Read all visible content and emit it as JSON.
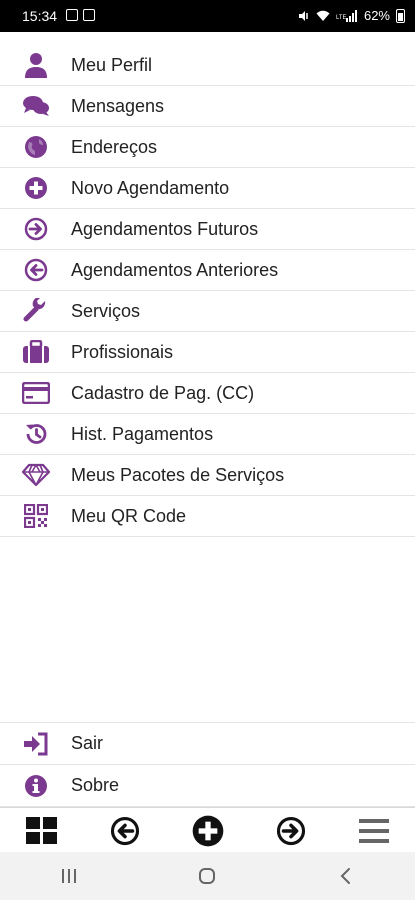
{
  "status_bar": {
    "time": "15:34",
    "battery": "62%"
  },
  "colors": {
    "accent": "#7b3a8f",
    "text": "#222222",
    "dark": "#111111"
  },
  "menu": {
    "items": [
      {
        "label": "Meu Perfil",
        "icon": "user-icon"
      },
      {
        "label": "Mensagens",
        "icon": "chat-icon"
      },
      {
        "label": "Endereços",
        "icon": "globe-icon"
      },
      {
        "label": "Novo Agendamento",
        "icon": "plus-circle-icon"
      },
      {
        "label": "Agendamentos Futuros",
        "icon": "arrow-right-circle-icon"
      },
      {
        "label": "Agendamentos Anteriores",
        "icon": "arrow-left-circle-icon"
      },
      {
        "label": "Serviços",
        "icon": "wrench-icon"
      },
      {
        "label": "Profissionais",
        "icon": "briefcase-icon"
      },
      {
        "label": "Cadastro de Pag. (CC)",
        "icon": "credit-card-icon"
      },
      {
        "label": "Hist. Pagamentos",
        "icon": "history-icon"
      },
      {
        "label": "Meus Pacotes de Serviços",
        "icon": "diamond-icon"
      },
      {
        "label": "Meu QR Code",
        "icon": "qrcode-icon"
      }
    ]
  },
  "bottom_menu": {
    "items": [
      {
        "label": "Sair",
        "icon": "sign-out-icon"
      },
      {
        "label": "Sobre",
        "icon": "info-icon"
      }
    ]
  },
  "tabbar": {
    "items": [
      "grid-icon",
      "arrow-left-circle-icon",
      "plus-circle-icon",
      "arrow-right-circle-icon",
      "menu-icon"
    ]
  },
  "navbar": {
    "items": [
      "recent-apps-icon",
      "home-icon",
      "back-icon"
    ]
  }
}
